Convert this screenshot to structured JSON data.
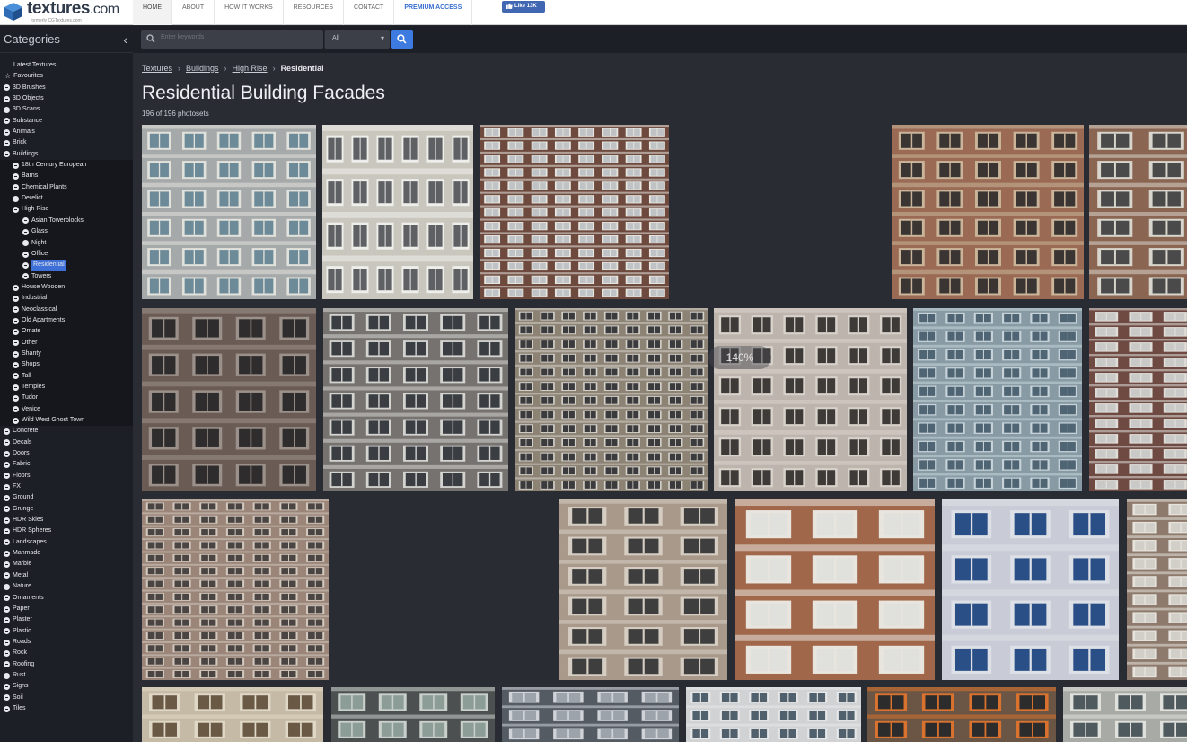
{
  "logo": {
    "brand": "textures",
    "domain": ".com",
    "tagline": "formerly CGTextures.com"
  },
  "nav": {
    "items": [
      {
        "label": "HOME",
        "active": true
      },
      {
        "label": "ABOUT"
      },
      {
        "label": "HOW IT WORKS"
      },
      {
        "label": "RESOURCES"
      },
      {
        "label": "CONTACT"
      },
      {
        "label": "PREMIUM ACCESS",
        "premium": true
      }
    ],
    "fb_like": "Like 13K"
  },
  "sidebar": {
    "title": "Categories",
    "collapse_icon": "chevron-left-icon",
    "items": [
      {
        "label": "Latest Textures",
        "level": "nobullet"
      },
      {
        "label": "Favourites",
        "level": "star"
      },
      {
        "label": "3D Brushes",
        "level": "lvl0"
      },
      {
        "label": "3D Objects",
        "level": "lvl0"
      },
      {
        "label": "3D Scans",
        "level": "lvl0"
      },
      {
        "label": "Substance",
        "level": "lvl0"
      },
      {
        "label": "Animals",
        "level": "lvl0"
      },
      {
        "label": "Brick",
        "level": "lvl0"
      },
      {
        "label": "Buildings",
        "level": "lvl0"
      },
      {
        "label": "18th Century European",
        "level": "lvl1"
      },
      {
        "label": "Barns",
        "level": "lvl1"
      },
      {
        "label": "Chemical Plants",
        "level": "lvl1"
      },
      {
        "label": "Derelict",
        "level": "lvl1"
      },
      {
        "label": "High Rise",
        "level": "lvl1"
      },
      {
        "label": "Asian Towerblocks",
        "level": "lvl2"
      },
      {
        "label": "Glass",
        "level": "lvl2"
      },
      {
        "label": "Night",
        "level": "lvl2"
      },
      {
        "label": "Office",
        "level": "lvl2"
      },
      {
        "label": "Residential",
        "level": "lvl2",
        "selected": true
      },
      {
        "label": "Towers",
        "level": "lvl2"
      },
      {
        "label": "House Wooden",
        "level": "lvl1"
      },
      {
        "label": "Industrial",
        "level": "lvl1"
      },
      {
        "label": "Neoclassical",
        "level": "lvl1"
      },
      {
        "label": "Old Apartments",
        "level": "lvl1"
      },
      {
        "label": "Ornate",
        "level": "lvl1"
      },
      {
        "label": "Other",
        "level": "lvl1"
      },
      {
        "label": "Shanty",
        "level": "lvl1"
      },
      {
        "label": "Shops",
        "level": "lvl1"
      },
      {
        "label": "Tall",
        "level": "lvl1"
      },
      {
        "label": "Temples",
        "level": "lvl1"
      },
      {
        "label": "Tudor",
        "level": "lvl1"
      },
      {
        "label": "Venice",
        "level": "lvl1"
      },
      {
        "label": "Wild West Ghost Town",
        "level": "lvl1"
      },
      {
        "label": "Concrete",
        "level": "lvl0"
      },
      {
        "label": "Decals",
        "level": "lvl0"
      },
      {
        "label": "Doors",
        "level": "lvl0"
      },
      {
        "label": "Fabric",
        "level": "lvl0"
      },
      {
        "label": "Floors",
        "level": "lvl0"
      },
      {
        "label": "FX",
        "level": "lvl0"
      },
      {
        "label": "Ground",
        "level": "lvl0"
      },
      {
        "label": "Grunge",
        "level": "lvl0"
      },
      {
        "label": "HDR Skies",
        "level": "lvl0"
      },
      {
        "label": "HDR Spheres",
        "level": "lvl0"
      },
      {
        "label": "Landscapes",
        "level": "lvl0"
      },
      {
        "label": "Manmade",
        "level": "lvl0"
      },
      {
        "label": "Marble",
        "level": "lvl0"
      },
      {
        "label": "Metal",
        "level": "lvl0"
      },
      {
        "label": "Nature",
        "level": "lvl0"
      },
      {
        "label": "Ornaments",
        "level": "lvl0"
      },
      {
        "label": "Paper",
        "level": "lvl0"
      },
      {
        "label": "Plaster",
        "level": "lvl0"
      },
      {
        "label": "Plastic",
        "level": "lvl0"
      },
      {
        "label": "Roads",
        "level": "lvl0"
      },
      {
        "label": "Rock",
        "level": "lvl0"
      },
      {
        "label": "Roofing",
        "level": "lvl0"
      },
      {
        "label": "Rust",
        "level": "lvl0"
      },
      {
        "label": "Signs",
        "level": "lvl0"
      },
      {
        "label": "Soil",
        "level": "lvl0"
      },
      {
        "label": "Tiles",
        "level": "lvl0"
      }
    ]
  },
  "search": {
    "placeholder": "Enter keywords",
    "select_value": "All",
    "button_icon": "search-icon"
  },
  "breadcrumb": {
    "links": [
      "Textures",
      "Buildings",
      "High Rise"
    ],
    "current": "Residential"
  },
  "page": {
    "title": "Residential Building Facades",
    "count": "196 of 196 photosets"
  },
  "zoom_indicator": "140%",
  "tiles": [
    {
      "name": "tile-facade-1",
      "bg": "#a6a9aa",
      "win": "#6d8a99",
      "frame": "#e2e2dc"
    },
    {
      "name": "tile-facade-2",
      "bg": "#c9c6be",
      "win": "#5e6064",
      "frame": "#eeeeea"
    },
    {
      "name": "tile-facade-3",
      "bg": "#6e4a3e",
      "win": "#bfc3c6",
      "frame": "#e8e6e0"
    },
    {
      "name": "tile-facade-4",
      "bg": "#9a6a55",
      "win": "#3a3532",
      "frame": "#cbb59a"
    },
    {
      "name": "tile-facade-5",
      "bg": "#8a6552",
      "win": "#4a4a4a",
      "frame": "#d8d5cc"
    },
    {
      "name": "tile-facade-6",
      "bg": "#6a5c55",
      "win": "#2e2c2c",
      "frame": "#9b918a"
    },
    {
      "name": "tile-facade-7",
      "bg": "#767270",
      "win": "#3a3d42",
      "frame": "#d3d3d0"
    },
    {
      "name": "tile-facade-8",
      "bg": "#8d8375",
      "win": "#3b3b3d",
      "frame": "#d5d2cb"
    },
    {
      "name": "tile-facade-9",
      "bg": "#bcb4ad",
      "win": "#3d3a38",
      "frame": "#d8d2cb"
    },
    {
      "name": "tile-facade-10",
      "bg": "#889ba5",
      "win": "#4f6574",
      "frame": "#c7d3d9"
    },
    {
      "name": "tile-facade-11",
      "bg": "#6e4a42",
      "win": "#c9c9c8",
      "frame": "#e0ddd8"
    },
    {
      "name": "tile-facade-12",
      "bg": "#9a8578",
      "win": "#4a4542",
      "frame": "#d3c9bf"
    },
    {
      "name": "tile-facade-13",
      "bg": "#a8998a",
      "win": "#3e3e3e",
      "frame": "#d5cdc2"
    },
    {
      "name": "tile-facade-14",
      "bg": "#a0674a",
      "win": "#e0e0dc",
      "frame": "#e8e4de"
    },
    {
      "name": "tile-facade-15",
      "bg": "#c9ccd6",
      "win": "#2a4f86",
      "frame": "#dde0e6"
    },
    {
      "name": "tile-facade-16",
      "bg": "#8d7a6c",
      "win": "#d2cfc9",
      "frame": "#e6e2dc"
    },
    {
      "name": "tile-facade-17",
      "bg": "#c5baa5",
      "win": "#6a5a45",
      "frame": "#e0d8c6"
    },
    {
      "name": "tile-facade-18",
      "bg": "#4c5050",
      "win": "#8c9c97",
      "frame": "#c9cfca"
    },
    {
      "name": "tile-facade-19",
      "bg": "#555b62",
      "win": "#9ca3ab",
      "frame": "#d0d4d8"
    },
    {
      "name": "tile-facade-20",
      "bg": "#d0d2d4",
      "win": "#50606c",
      "frame": "#e6e7e8"
    },
    {
      "name": "tile-facade-21",
      "bg": "#6b5544",
      "win": "#2c2c2c",
      "frame": "#d9722e"
    },
    {
      "name": "tile-facade-22",
      "bg": "#a8aaa6",
      "win": "#4f5a5e",
      "frame": "#e0e0dc"
    }
  ]
}
